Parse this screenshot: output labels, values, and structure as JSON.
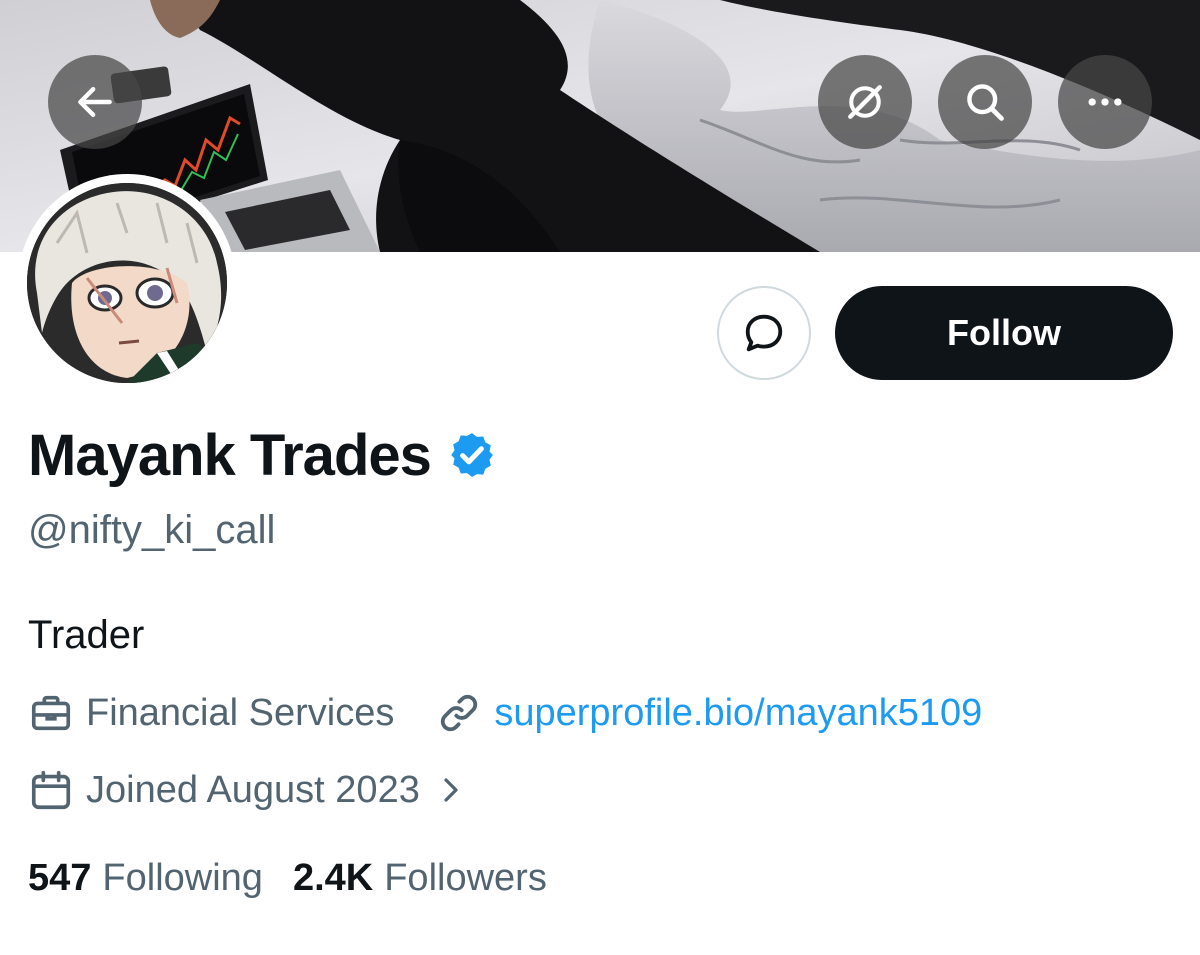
{
  "profile": {
    "display_name": "Mayank Trades",
    "handle": "@nifty_ki_call",
    "bio": "Trader",
    "category": "Financial Services",
    "website": "superprofile.bio/mayank5109",
    "joined": "Joined August 2023",
    "following_count": "547",
    "following_label": "Following",
    "followers_count": "2.4K",
    "followers_label": "Followers"
  },
  "actions": {
    "follow_label": "Follow"
  },
  "colors": {
    "accent": "#1d9bf0",
    "text_primary": "#0f1419",
    "text_secondary": "#536471",
    "follow_bg": "#0f1419",
    "verified": "#1d9bf0"
  },
  "icons": {
    "back": "arrow-left-icon",
    "grok": "grok-icon",
    "search": "search-icon",
    "more": "more-dots-icon",
    "message": "message-bubble-icon",
    "verified": "verified-badge-icon",
    "category": "briefcase-icon",
    "website": "link-icon",
    "joined": "calendar-icon",
    "joined_more": "chevron-right-icon"
  }
}
